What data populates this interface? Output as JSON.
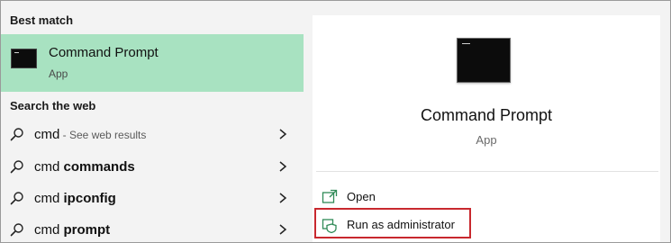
{
  "left_pane": {
    "best_match_header": "Best match",
    "best_match": {
      "title": "Command Prompt",
      "subtitle": "App",
      "icon": "command-prompt-icon"
    },
    "search_web_header": "Search the web",
    "web_results": [
      {
        "prefix": "cmd",
        "bold": "",
        "suffix": " - See web results"
      },
      {
        "prefix": "cmd ",
        "bold": "commands",
        "suffix": ""
      },
      {
        "prefix": "cmd ",
        "bold": "ipconfig",
        "suffix": ""
      },
      {
        "prefix": "cmd ",
        "bold": "prompt",
        "suffix": ""
      }
    ]
  },
  "right_pane": {
    "title": "Command Prompt",
    "subtitle": "App",
    "actions": [
      {
        "label": "Open",
        "icon": "open-icon"
      },
      {
        "label": "Run as administrator",
        "icon": "shield-icon"
      }
    ]
  },
  "colors": {
    "selection": "#a8e2c1",
    "highlight_border": "#c8282e"
  }
}
